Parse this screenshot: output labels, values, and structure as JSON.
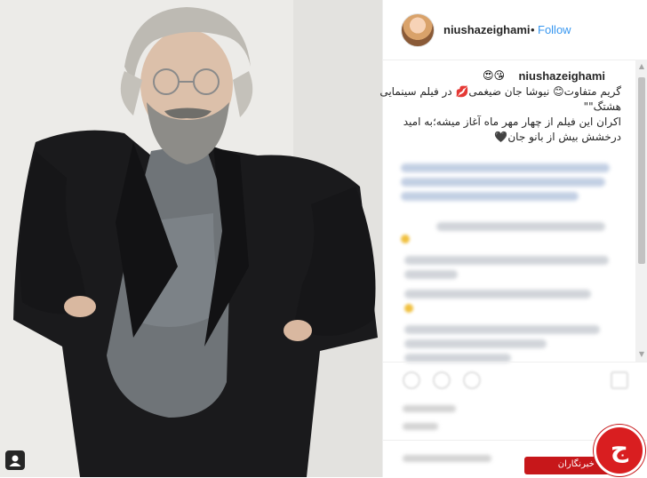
{
  "post": {
    "username": "niushazeighami",
    "separator": "•",
    "follow_label": "Follow"
  },
  "caption": {
    "username": "niushazeighami",
    "emoji": "😍😘",
    "lines": [
      "گریم متفاوت😊 نیوشا جان ضیغمی💋 در فیلم سینمایی",
      "هشتگ\"\"",
      "اکران این فیلم از چهار مهر ماه آغاز میشه؛به امید",
      "درخشش بیش از بانو جان🖤"
    ]
  },
  "watermark": {
    "text": "باشگاه خبرنگاران",
    "glyph": "ج"
  },
  "colors": {
    "accent": "#3897f0",
    "brand_red": "#c7171a"
  },
  "icons": [
    "user-tag-icon",
    "like-icon",
    "comment-icon",
    "share-icon",
    "bookmark-icon",
    "scroll-up-icon",
    "scroll-down-icon"
  ]
}
